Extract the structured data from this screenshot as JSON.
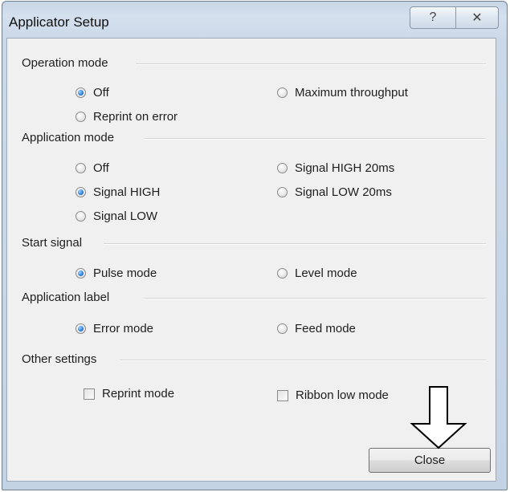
{
  "window": {
    "title": "Applicator Setup",
    "help_glyph": "?",
    "close_glyph": "✕"
  },
  "groups": {
    "operation_mode": {
      "label": "Operation mode",
      "options": [
        {
          "label": "Off",
          "checked": true
        },
        {
          "label": "Maximum throughput",
          "checked": false
        },
        {
          "label": "Reprint on error",
          "checked": false
        }
      ]
    },
    "application_mode": {
      "label": "Application mode",
      "options": [
        {
          "label": "Off",
          "checked": false
        },
        {
          "label": "Signal HIGH 20ms",
          "checked": false
        },
        {
          "label": "Signal HIGH",
          "checked": true
        },
        {
          "label": "Signal LOW 20ms",
          "checked": false
        },
        {
          "label": "Signal LOW",
          "checked": false
        }
      ]
    },
    "start_signal": {
      "label": "Start signal",
      "options": [
        {
          "label": "Pulse mode",
          "checked": true
        },
        {
          "label": "Level mode",
          "checked": false
        }
      ]
    },
    "application_label": {
      "label": "Application label",
      "options": [
        {
          "label": "Error mode",
          "checked": true
        },
        {
          "label": "Feed mode",
          "checked": false
        }
      ]
    },
    "other_settings": {
      "label": "Other settings",
      "options": [
        {
          "label": "Reprint mode",
          "checked": false
        },
        {
          "label": "Ribbon low mode",
          "checked": false
        }
      ]
    }
  },
  "buttons": {
    "close": "Close"
  },
  "annotation": {
    "icon": "down-arrow-icon"
  }
}
